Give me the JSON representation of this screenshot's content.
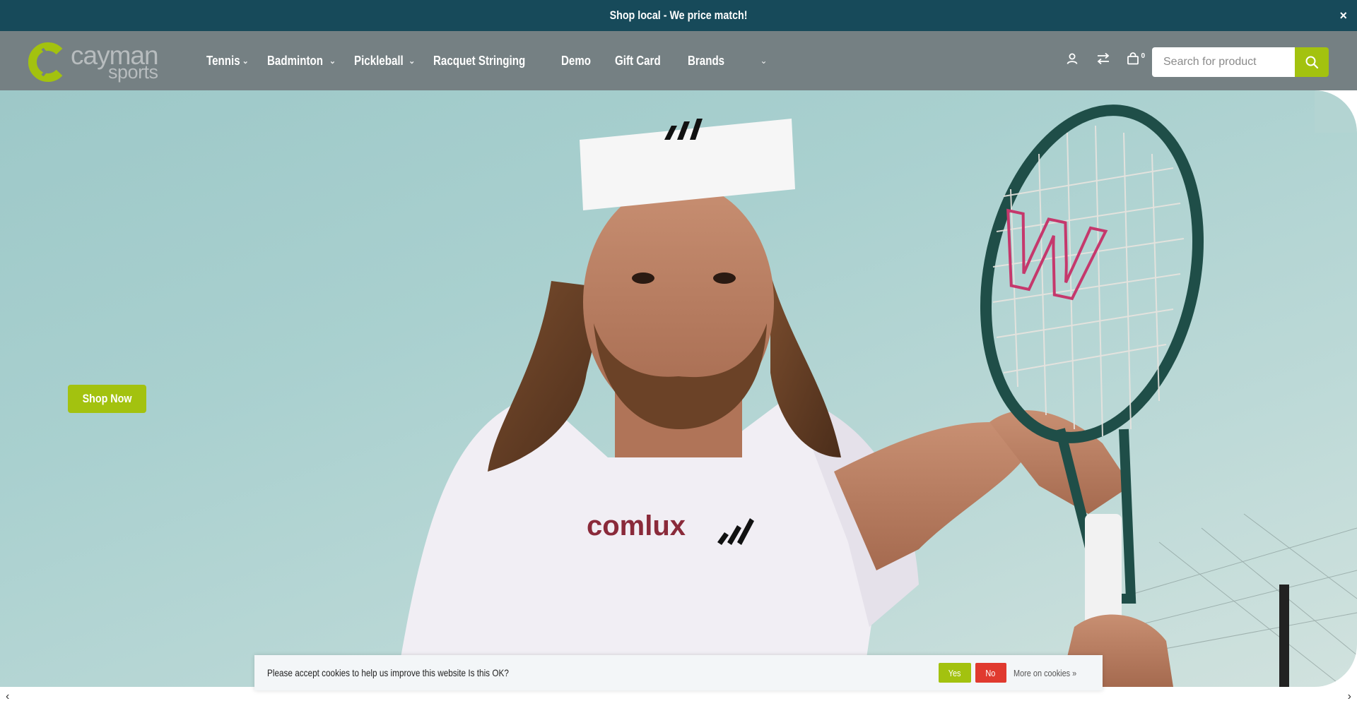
{
  "announcement": {
    "text": "Shop local - We price match!",
    "close": "×"
  },
  "brand": {
    "name_line1": "cayman",
    "name_line2": "sports",
    "accent_color": "#a3c20f",
    "header_color": "#758083",
    "announcement_color": "#174a5a"
  },
  "nav": {
    "items": [
      {
        "label": "Tennis",
        "has_dropdown": true
      },
      {
        "label": "Badminton",
        "has_dropdown": true
      },
      {
        "label": "Pickleball",
        "has_dropdown": true
      },
      {
        "label": "Racquet Stringing",
        "has_dropdown": false
      },
      {
        "label": "Demo",
        "has_dropdown": false
      },
      {
        "label": "Gift Card",
        "has_dropdown": false
      },
      {
        "label": "Brands",
        "has_dropdown": false
      }
    ],
    "more_icon": "chevron-down-icon"
  },
  "header_icons": {
    "account": "user-icon",
    "compare": "compare-icon",
    "cart": "bag-icon",
    "cart_count": "0"
  },
  "search": {
    "placeholder": "Search for product",
    "value": "",
    "icon": "search-icon"
  },
  "hero": {
    "cta_label": "Shop Now"
  },
  "cookie": {
    "message": "Please accept cookies to help us improve this website Is this OK?",
    "yes": "Yes",
    "no": "No",
    "more": "More on cookies »"
  }
}
